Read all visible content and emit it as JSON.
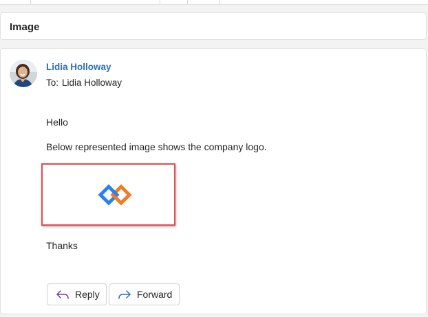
{
  "subject": "Image",
  "message": {
    "sender_name": "Lidia Holloway",
    "to_label": "To:",
    "to_recipient": "Lidia Holloway",
    "greeting": "Hello",
    "intro": "Below represented image shows the company logo.",
    "closing": "Thanks"
  },
  "actions": {
    "reply_label": "Reply",
    "forward_label": "Forward"
  },
  "icons": {
    "reply": "reply-arrow-icon",
    "forward": "forward-arrow-icon",
    "logo": "company-logo-interlocked-diamonds"
  },
  "colors": {
    "sender_link": "#2b6fb6",
    "highlight_border": "#e04b4b",
    "logo_blue": "#2f80ed",
    "logo_orange": "#f07b23"
  }
}
